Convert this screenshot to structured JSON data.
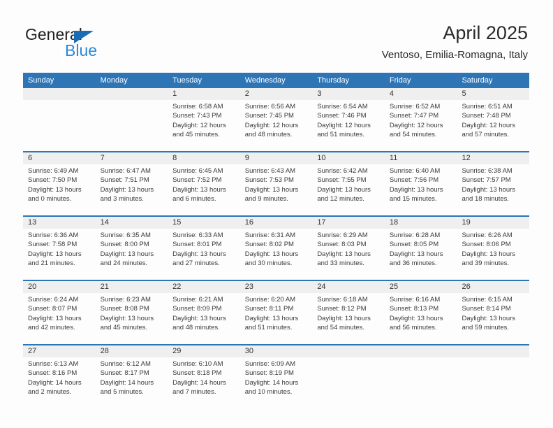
{
  "brand": {
    "name_top": "General",
    "name_bottom": "Blue",
    "triangle_icon": "triangle-icon",
    "color_dark": "#231f20",
    "color_blue": "#2b88d8"
  },
  "header": {
    "title": "April 2025",
    "subtitle": "Ventoso, Emilia-Romagna, Italy"
  },
  "theme": {
    "header_blue": "#2e75b6",
    "band_gray": "#efefef",
    "text": "#3a3a3a"
  },
  "weekdays": [
    "Sunday",
    "Monday",
    "Tuesday",
    "Wednesday",
    "Thursday",
    "Friday",
    "Saturday"
  ],
  "weeks": [
    [
      {
        "day": "",
        "empty": true,
        "sunrise": "",
        "sunset": "",
        "daylight_line1": "",
        "daylight_line2": ""
      },
      {
        "day": "",
        "empty": true,
        "sunrise": "",
        "sunset": "",
        "daylight_line1": "",
        "daylight_line2": ""
      },
      {
        "day": "1",
        "sunrise": "Sunrise: 6:58 AM",
        "sunset": "Sunset: 7:43 PM",
        "daylight_line1": "Daylight: 12 hours",
        "daylight_line2": "and 45 minutes."
      },
      {
        "day": "2",
        "sunrise": "Sunrise: 6:56 AM",
        "sunset": "Sunset: 7:45 PM",
        "daylight_line1": "Daylight: 12 hours",
        "daylight_line2": "and 48 minutes."
      },
      {
        "day": "3",
        "sunrise": "Sunrise: 6:54 AM",
        "sunset": "Sunset: 7:46 PM",
        "daylight_line1": "Daylight: 12 hours",
        "daylight_line2": "and 51 minutes."
      },
      {
        "day": "4",
        "sunrise": "Sunrise: 6:52 AM",
        "sunset": "Sunset: 7:47 PM",
        "daylight_line1": "Daylight: 12 hours",
        "daylight_line2": "and 54 minutes."
      },
      {
        "day": "5",
        "sunrise": "Sunrise: 6:51 AM",
        "sunset": "Sunset: 7:48 PM",
        "daylight_line1": "Daylight: 12 hours",
        "daylight_line2": "and 57 minutes."
      }
    ],
    [
      {
        "day": "6",
        "sunrise": "Sunrise: 6:49 AM",
        "sunset": "Sunset: 7:50 PM",
        "daylight_line1": "Daylight: 13 hours",
        "daylight_line2": "and 0 minutes."
      },
      {
        "day": "7",
        "sunrise": "Sunrise: 6:47 AM",
        "sunset": "Sunset: 7:51 PM",
        "daylight_line1": "Daylight: 13 hours",
        "daylight_line2": "and 3 minutes."
      },
      {
        "day": "8",
        "sunrise": "Sunrise: 6:45 AM",
        "sunset": "Sunset: 7:52 PM",
        "daylight_line1": "Daylight: 13 hours",
        "daylight_line2": "and 6 minutes."
      },
      {
        "day": "9",
        "sunrise": "Sunrise: 6:43 AM",
        "sunset": "Sunset: 7:53 PM",
        "daylight_line1": "Daylight: 13 hours",
        "daylight_line2": "and 9 minutes."
      },
      {
        "day": "10",
        "sunrise": "Sunrise: 6:42 AM",
        "sunset": "Sunset: 7:55 PM",
        "daylight_line1": "Daylight: 13 hours",
        "daylight_line2": "and 12 minutes."
      },
      {
        "day": "11",
        "sunrise": "Sunrise: 6:40 AM",
        "sunset": "Sunset: 7:56 PM",
        "daylight_line1": "Daylight: 13 hours",
        "daylight_line2": "and 15 minutes."
      },
      {
        "day": "12",
        "sunrise": "Sunrise: 6:38 AM",
        "sunset": "Sunset: 7:57 PM",
        "daylight_line1": "Daylight: 13 hours",
        "daylight_line2": "and 18 minutes."
      }
    ],
    [
      {
        "day": "13",
        "sunrise": "Sunrise: 6:36 AM",
        "sunset": "Sunset: 7:58 PM",
        "daylight_line1": "Daylight: 13 hours",
        "daylight_line2": "and 21 minutes."
      },
      {
        "day": "14",
        "sunrise": "Sunrise: 6:35 AM",
        "sunset": "Sunset: 8:00 PM",
        "daylight_line1": "Daylight: 13 hours",
        "daylight_line2": "and 24 minutes."
      },
      {
        "day": "15",
        "sunrise": "Sunrise: 6:33 AM",
        "sunset": "Sunset: 8:01 PM",
        "daylight_line1": "Daylight: 13 hours",
        "daylight_line2": "and 27 minutes."
      },
      {
        "day": "16",
        "sunrise": "Sunrise: 6:31 AM",
        "sunset": "Sunset: 8:02 PM",
        "daylight_line1": "Daylight: 13 hours",
        "daylight_line2": "and 30 minutes."
      },
      {
        "day": "17",
        "sunrise": "Sunrise: 6:29 AM",
        "sunset": "Sunset: 8:03 PM",
        "daylight_line1": "Daylight: 13 hours",
        "daylight_line2": "and 33 minutes."
      },
      {
        "day": "18",
        "sunrise": "Sunrise: 6:28 AM",
        "sunset": "Sunset: 8:05 PM",
        "daylight_line1": "Daylight: 13 hours",
        "daylight_line2": "and 36 minutes."
      },
      {
        "day": "19",
        "sunrise": "Sunrise: 6:26 AM",
        "sunset": "Sunset: 8:06 PM",
        "daylight_line1": "Daylight: 13 hours",
        "daylight_line2": "and 39 minutes."
      }
    ],
    [
      {
        "day": "20",
        "sunrise": "Sunrise: 6:24 AM",
        "sunset": "Sunset: 8:07 PM",
        "daylight_line1": "Daylight: 13 hours",
        "daylight_line2": "and 42 minutes."
      },
      {
        "day": "21",
        "sunrise": "Sunrise: 6:23 AM",
        "sunset": "Sunset: 8:08 PM",
        "daylight_line1": "Daylight: 13 hours",
        "daylight_line2": "and 45 minutes."
      },
      {
        "day": "22",
        "sunrise": "Sunrise: 6:21 AM",
        "sunset": "Sunset: 8:09 PM",
        "daylight_line1": "Daylight: 13 hours",
        "daylight_line2": "and 48 minutes."
      },
      {
        "day": "23",
        "sunrise": "Sunrise: 6:20 AM",
        "sunset": "Sunset: 8:11 PM",
        "daylight_line1": "Daylight: 13 hours",
        "daylight_line2": "and 51 minutes."
      },
      {
        "day": "24",
        "sunrise": "Sunrise: 6:18 AM",
        "sunset": "Sunset: 8:12 PM",
        "daylight_line1": "Daylight: 13 hours",
        "daylight_line2": "and 54 minutes."
      },
      {
        "day": "25",
        "sunrise": "Sunrise: 6:16 AM",
        "sunset": "Sunset: 8:13 PM",
        "daylight_line1": "Daylight: 13 hours",
        "daylight_line2": "and 56 minutes."
      },
      {
        "day": "26",
        "sunrise": "Sunrise: 6:15 AM",
        "sunset": "Sunset: 8:14 PM",
        "daylight_line1": "Daylight: 13 hours",
        "daylight_line2": "and 59 minutes."
      }
    ],
    [
      {
        "day": "27",
        "sunrise": "Sunrise: 6:13 AM",
        "sunset": "Sunset: 8:16 PM",
        "daylight_line1": "Daylight: 14 hours",
        "daylight_line2": "and 2 minutes."
      },
      {
        "day": "28",
        "sunrise": "Sunrise: 6:12 AM",
        "sunset": "Sunset: 8:17 PM",
        "daylight_line1": "Daylight: 14 hours",
        "daylight_line2": "and 5 minutes."
      },
      {
        "day": "29",
        "sunrise": "Sunrise: 6:10 AM",
        "sunset": "Sunset: 8:18 PM",
        "daylight_line1": "Daylight: 14 hours",
        "daylight_line2": "and 7 minutes."
      },
      {
        "day": "30",
        "sunrise": "Sunrise: 6:09 AM",
        "sunset": "Sunset: 8:19 PM",
        "daylight_line1": "Daylight: 14 hours",
        "daylight_line2": "and 10 minutes."
      },
      {
        "day": "",
        "empty": true,
        "sunrise": "",
        "sunset": "",
        "daylight_line1": "",
        "daylight_line2": ""
      },
      {
        "day": "",
        "empty": true,
        "sunrise": "",
        "sunset": "",
        "daylight_line1": "",
        "daylight_line2": ""
      },
      {
        "day": "",
        "empty": true,
        "sunrise": "",
        "sunset": "",
        "daylight_line1": "",
        "daylight_line2": ""
      }
    ]
  ]
}
